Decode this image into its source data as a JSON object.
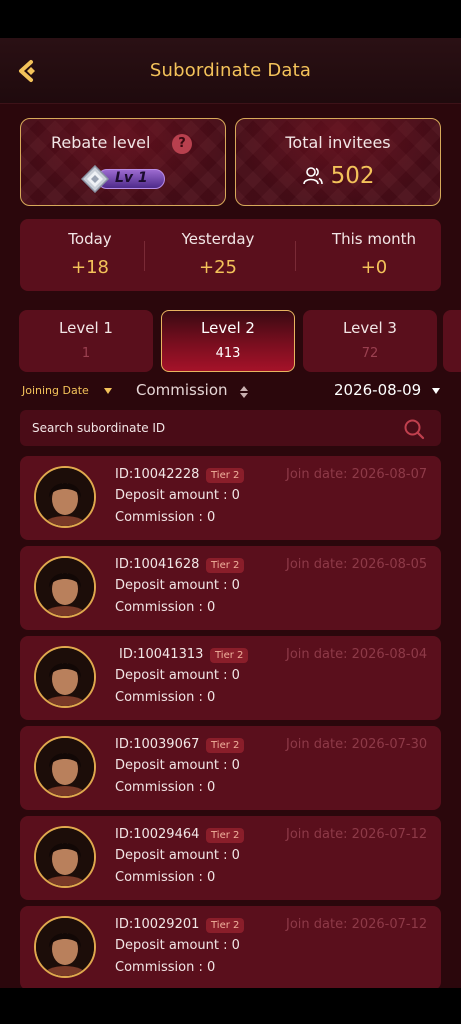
{
  "header": {
    "title": "Subordinate Data",
    "back_icon": "back-chevron-icon"
  },
  "rebate": {
    "label": "Rebate level",
    "help": "?",
    "level": "Lv 1"
  },
  "invitees": {
    "label": "Total invitees",
    "count": "502"
  },
  "period": [
    {
      "label": "Today",
      "value": "+18"
    },
    {
      "label": "Yesterday",
      "value": "+25"
    },
    {
      "label": "This month",
      "value": "+0"
    }
  ],
  "tabs": [
    {
      "label": "Level 1",
      "count": "1"
    },
    {
      "label": "Level 2",
      "count": "413",
      "active": true
    },
    {
      "label": "Level 3",
      "count": "72"
    }
  ],
  "filters": {
    "joining": "Joining Date",
    "commission": "Commission",
    "date": "2026-08-09"
  },
  "search": {
    "placeholder": "Search subordinate ID"
  },
  "items": [
    {
      "id": "ID:10042228",
      "tier": "Tier 2",
      "join": "Join date: 2026-08-07",
      "deposit": "Deposit amount : 0",
      "commission": "Commission : 0"
    },
    {
      "id": "ID:10041628",
      "tier": "Tier 2",
      "join": "Join date: 2026-08-05",
      "deposit": "Deposit amount : 0",
      "commission": "Commission : 0"
    },
    {
      "id": "ID:10041313",
      "tier": "Tier 2",
      "join": "Join date: 2026-08-04",
      "deposit": "Deposit amount : 0",
      "commission": "Commission : 0"
    },
    {
      "id": "ID:10039067",
      "tier": "Tier 2",
      "join": "Join date: 2026-07-30",
      "deposit": "Deposit amount : 0",
      "commission": "Commission : 0"
    },
    {
      "id": "ID:10029464",
      "tier": "Tier 2",
      "join": "Join date: 2026-07-12",
      "deposit": "Deposit amount : 0",
      "commission": "Commission : 0"
    },
    {
      "id": "ID:10029201",
      "tier": "Tier 2",
      "join": "Join date: 2026-07-12",
      "deposit": "Deposit amount : 0",
      "commission": "Commission : 0"
    }
  ],
  "colors": {
    "accent": "#f3c25a",
    "background": "#2b070c",
    "card": "#5a0f1c",
    "border_gold": "#d7a95a"
  }
}
